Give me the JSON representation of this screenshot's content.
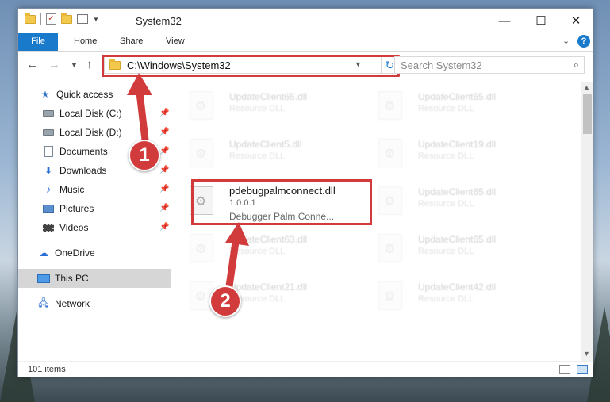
{
  "window": {
    "title": "System32"
  },
  "ribbon": {
    "tabs": [
      "File",
      "Home",
      "Share",
      "View"
    ]
  },
  "address": {
    "path": "C:\\Windows\\System32"
  },
  "search": {
    "placeholder": "Search System32"
  },
  "sidebar": {
    "items": [
      {
        "label": "Quick access",
        "icon": "star-icon"
      },
      {
        "label": "Local Disk (C:)",
        "icon": "disk-icon",
        "pinned": true
      },
      {
        "label": "Local Disk (D:)",
        "icon": "disk-icon",
        "pinned": true
      },
      {
        "label": "Documents",
        "icon": "documents-icon",
        "pinned": true
      },
      {
        "label": "Downloads",
        "icon": "downloads-icon",
        "pinned": true
      },
      {
        "label": "Music",
        "icon": "music-icon",
        "pinned": true
      },
      {
        "label": "Pictures",
        "icon": "pictures-icon",
        "pinned": true
      },
      {
        "label": "Videos",
        "icon": "videos-icon",
        "pinned": true
      },
      {
        "label": "OneDrive",
        "icon": "onedrive-icon"
      },
      {
        "label": "This PC",
        "icon": "this-pc-icon",
        "selected": true
      },
      {
        "label": "Network",
        "icon": "network-icon"
      }
    ]
  },
  "files": [
    {
      "name": "UpdateClient65.dll",
      "desc": "Resource DLL"
    },
    {
      "name": "UpdateClient65.dll",
      "desc": "Resource DLL"
    },
    {
      "name": "UpdateClient5.dll",
      "desc": "Resource DLL"
    },
    {
      "name": "UpdateClient19.dll",
      "desc": "Resource DLL"
    },
    {
      "name": "pdebugpalmconnect.dll",
      "version": "1.0.0.1",
      "desc": "Debugger Palm Conne..."
    },
    {
      "name": "UpdateClient65.dll",
      "desc": "Resource DLL"
    },
    {
      "name": "UpdateClient63.dll",
      "desc": "Resource DLL"
    },
    {
      "name": "UpdateClient65.dll",
      "desc": "Resource DLL"
    },
    {
      "name": "UpdateClient21.dll",
      "desc": "Resource DLL"
    },
    {
      "name": "UpdateClient42.dll",
      "desc": "Resource DLL"
    }
  ],
  "status": {
    "item_count": "101 items"
  },
  "annotations": {
    "step1": "1",
    "step2": "2",
    "color": "#d23b3b"
  }
}
